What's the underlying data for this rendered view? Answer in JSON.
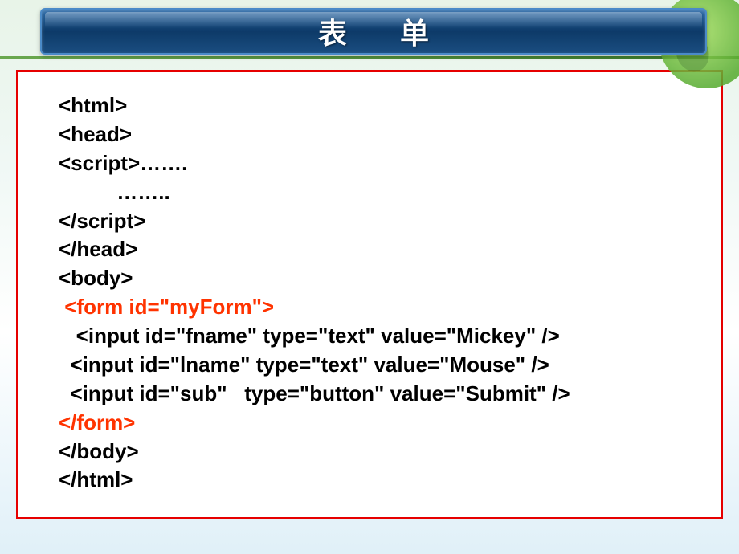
{
  "title": "表 单",
  "code": {
    "l1": "<html>",
    "l2": "<head>",
    "l3": "<script>…….",
    "l4": "          ……..",
    "l5": "</script>",
    "l6": "</head>",
    "l7": "<body>",
    "l8": " <form id=\"myForm\">",
    "l9": "   <input id=\"fname\" type=\"text\" value=\"Mickey\" />",
    "l10": "  <input id=\"lname\" type=\"text\" value=\"Mouse\" />",
    "l11_a": "  <input id=\"sub",
    "l11_b": "\"   type=\"button\" value=\"Submit\" />",
    "l12": "</form>",
    "l13": "</body>",
    "l14": "</html>"
  }
}
